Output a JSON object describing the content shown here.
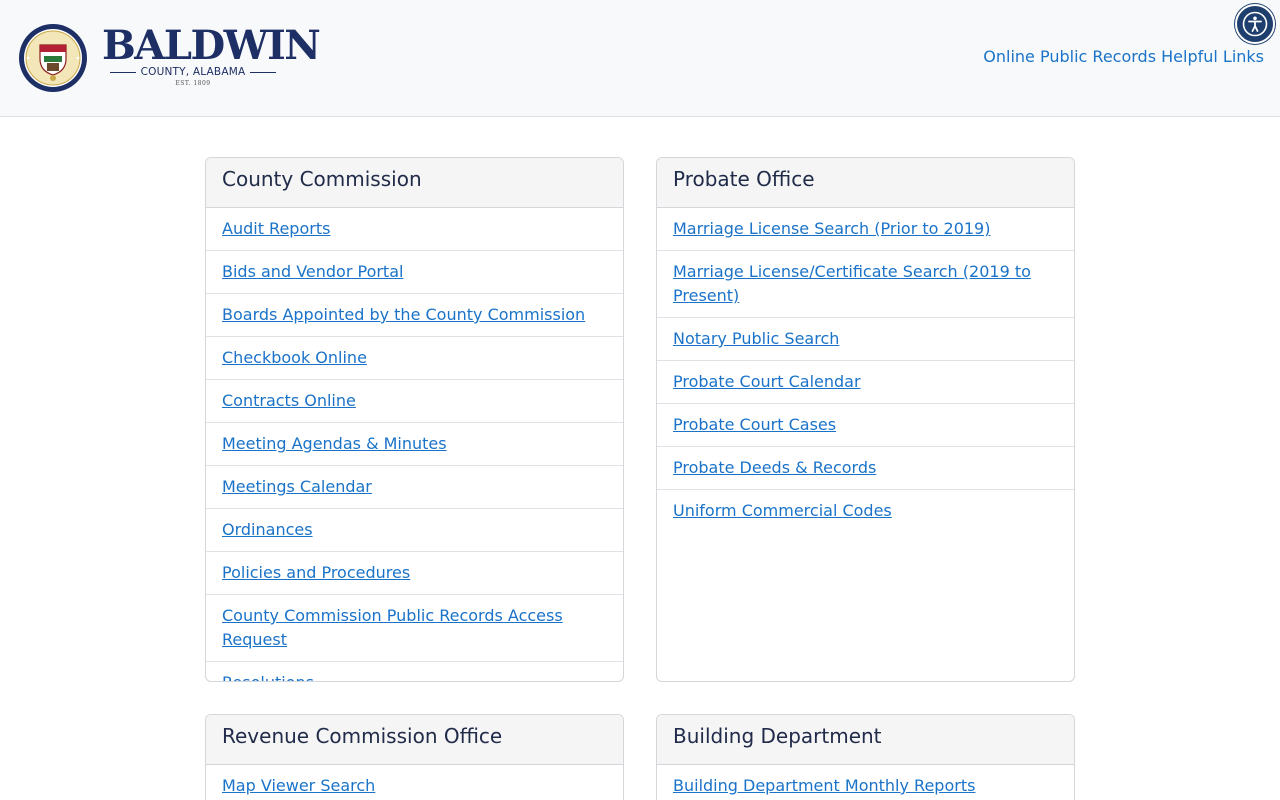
{
  "header": {
    "seal_text": "THE SEAL OF BALDWIN COUNTY ALABAMA",
    "seal_year": "1809",
    "brand_name": "BALDWIN",
    "brand_sub": "COUNTY, ALABAMA",
    "brand_est": "EST. 1809",
    "helpful_links_label": "Online Public Records Helpful Links",
    "accessibility_icon": "accessibility-icon"
  },
  "colors": {
    "link": "#1a73c9",
    "brand_navy": "#1e2f66",
    "header_bg": "#f8f9fa",
    "card_header_bg": "#f5f5f5"
  },
  "cards": {
    "county_commission": {
      "title": "County Commission",
      "links": [
        "Audit Reports",
        "Bids and Vendor Portal",
        "Boards Appointed by the County Commission",
        "Checkbook Online",
        "Contracts Online",
        "Meeting Agendas & Minutes",
        "Meetings Calendar",
        "Ordinances",
        "Policies and Procedures",
        "County Commission Public Records Access Request",
        "Resolutions"
      ]
    },
    "probate_office": {
      "title": "Probate Office",
      "links": [
        "Marriage License Search (Prior to 2019)",
        "Marriage License/Certificate Search (2019 to Present)",
        "Notary Public Search",
        "Probate Court Calendar",
        "Probate Court Cases",
        "Probate Deeds & Records",
        "Uniform Commercial Codes"
      ]
    },
    "revenue_commission": {
      "title": "Revenue Commission Office",
      "links": [
        "Map Viewer Search"
      ]
    },
    "building_department": {
      "title": "Building Department",
      "links": [
        "Building Department Monthly Reports"
      ]
    }
  }
}
